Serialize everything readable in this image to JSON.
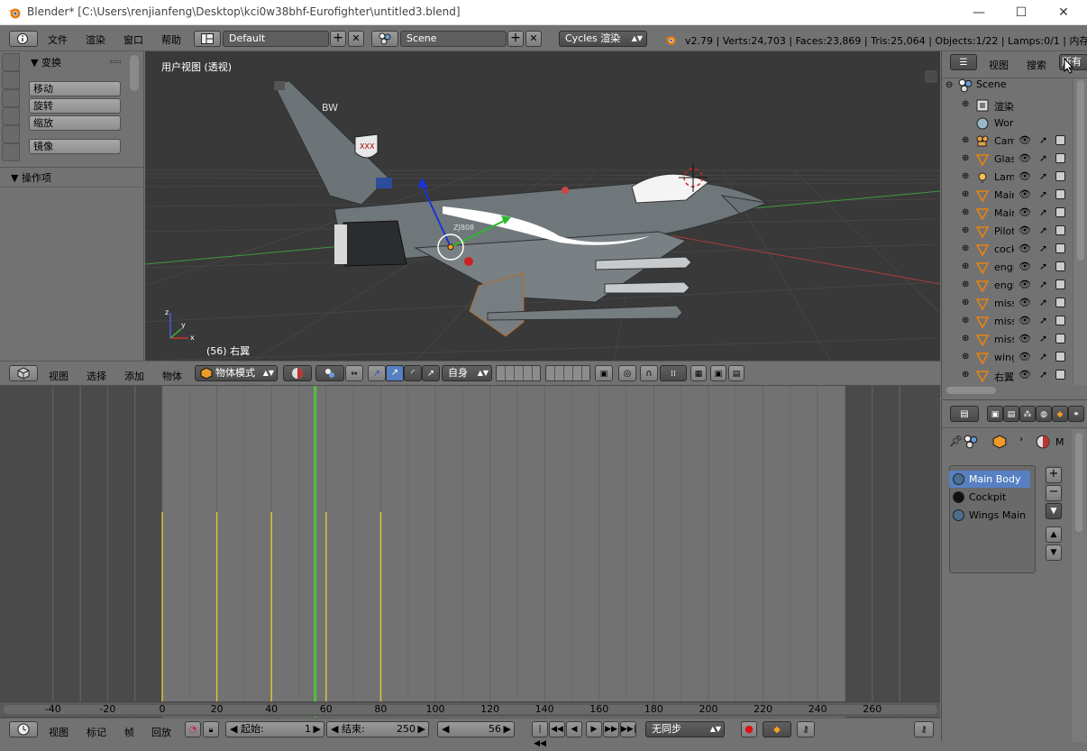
{
  "window": {
    "title": "Blender* [C:\\Users\\renjianfeng\\Desktop\\kci0w38bhf-Eurofighter\\untitled3.blend]",
    "minimize": "—",
    "maximize": "☐",
    "close": "✕"
  },
  "info_header": {
    "menus": [
      "文件",
      "渲染",
      "窗口",
      "帮助"
    ],
    "layout": "Default",
    "scene": "Scene",
    "engine": "Cycles 渲染",
    "stats": "v2.79 | Verts:24,703 | Faces:23,869 | Tris:25,064 | Objects:1/22 | Lamps:0/1 | 内存:25"
  },
  "tool_shelf": {
    "transform_header": "变换",
    "buttons": [
      "移动",
      "旋转",
      "缩放",
      "镜像"
    ],
    "operator_header": "操作项"
  },
  "viewport": {
    "title": "用户视图 (透视)",
    "object_label": "(56) 右翼",
    "tail_code": "BW",
    "serial": "ZJ808"
  },
  "view3d_header": {
    "menus": [
      "视图",
      "选择",
      "添加",
      "物体"
    ],
    "mode": "物体模式",
    "orientation": "自身"
  },
  "outliner": {
    "tabs": [
      "视图",
      "搜索",
      "所有"
    ],
    "root": "Scene",
    "rows": [
      {
        "name": "渲染",
        "type": "render"
      },
      {
        "name": "World",
        "type": "world"
      },
      {
        "name": "Camera",
        "type": "camera"
      },
      {
        "name": "Glass",
        "type": "mesh"
      },
      {
        "name": "Lamp",
        "type": "lamp"
      },
      {
        "name": "Main",
        "type": "mesh"
      },
      {
        "name": "Main",
        "type": "mesh"
      },
      {
        "name": "Pilot",
        "type": "mesh"
      },
      {
        "name": "cockpit",
        "type": "mesh"
      },
      {
        "name": "engine",
        "type": "mesh"
      },
      {
        "name": "engine",
        "type": "mesh"
      },
      {
        "name": "missile",
        "type": "mesh"
      },
      {
        "name": "missile",
        "type": "mesh"
      },
      {
        "name": "missile",
        "type": "mesh"
      },
      {
        "name": "wings",
        "type": "mesh"
      },
      {
        "name": "右翼",
        "type": "mesh"
      }
    ]
  },
  "properties": {
    "breadcrumb_end": "M",
    "materials": [
      "Main Body",
      "Cockpit",
      "Wings Main"
    ],
    "selected_material": "Main Body"
  },
  "timeline": {
    "ruler": [
      "-40",
      "-20",
      "0",
      "20",
      "40",
      "60",
      "80",
      "100",
      "120",
      "140",
      "160",
      "180",
      "200",
      "220",
      "240",
      "260"
    ],
    "current_frame": 56,
    "keyframes": [
      0,
      20,
      40,
      60,
      80
    ],
    "menus": [
      "视图",
      "标记",
      "帧",
      "回放"
    ],
    "start_label": "起始:",
    "start": "1",
    "end_label": "结束:",
    "end": "250",
    "frame": "56",
    "sync": "无同步"
  },
  "colors": {
    "accent_blue": "#5680c2",
    "current_frame": "#4fc43c",
    "keyframe": "#d9c43a",
    "viewport_bg": "#393939"
  }
}
